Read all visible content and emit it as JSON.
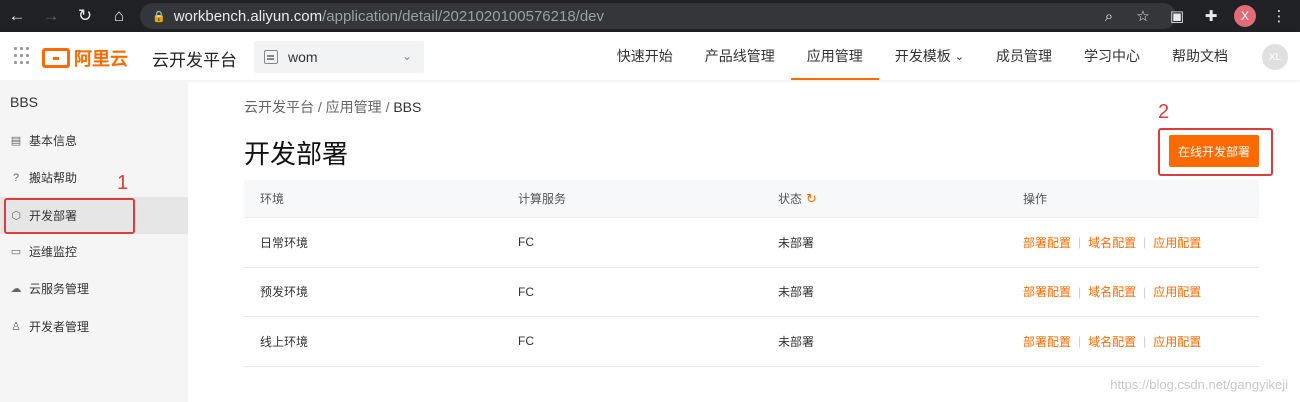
{
  "browser": {
    "url_host": "workbench.aliyun.com",
    "url_path": "/application/detail/2021020100576218/dev",
    "profile_initial": "X"
  },
  "header": {
    "logo_text": "阿里云",
    "platform": "云开发平台",
    "workspace": "wom",
    "nav": [
      "快速开始",
      "产品线管理",
      "应用管理",
      "开发模板",
      "成员管理",
      "学习中心",
      "帮助文档"
    ],
    "active_nav": "应用管理",
    "avatar": "XL"
  },
  "sidebar": {
    "title": "BBS",
    "items": [
      {
        "label": "基本信息",
        "icon": "document-icon"
      },
      {
        "label": "搬站帮助",
        "icon": "help-circle-icon"
      },
      {
        "label": "开发部署",
        "icon": "cube-icon"
      },
      {
        "label": "运维监控",
        "icon": "monitor-icon"
      },
      {
        "label": "云服务管理",
        "icon": "cloud-icon"
      },
      {
        "label": "开发者管理",
        "icon": "user-icon"
      }
    ],
    "active_index": 2
  },
  "annotations": {
    "one": "1",
    "two": "2",
    "color": "#e03b3b"
  },
  "breadcrumb": {
    "items": [
      "云开发平台",
      "应用管理"
    ],
    "separator": "/",
    "current": "BBS"
  },
  "page_title": "开发部署",
  "primary_button": "在线开发部署",
  "table": {
    "headers": [
      "环境",
      "计算服务",
      "状态",
      "操作"
    ],
    "rows": [
      {
        "env": "日常环境",
        "service": "FC",
        "status": "未部署"
      },
      {
        "env": "预发环境",
        "service": "FC",
        "status": "未部署"
      },
      {
        "env": "线上环境",
        "service": "FC",
        "status": "未部署"
      }
    ],
    "actions": [
      "部署配置",
      "域名配置",
      "应用配置"
    ],
    "separator": "|"
  },
  "watermark": "https://blog.csdn.net/gangyikeji",
  "colors": {
    "accent": "#ff6a00",
    "sidebar_bg": "#f5f5f5",
    "chrome_bg": "#202124"
  }
}
